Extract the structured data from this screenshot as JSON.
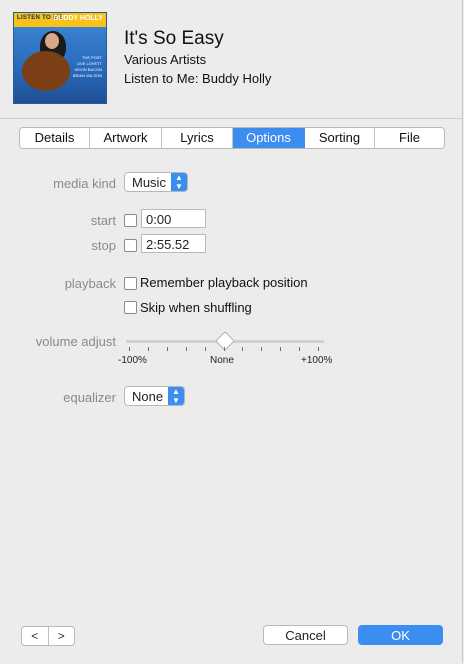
{
  "header": {
    "album_art": {
      "band_left": "LISTEN TO ME",
      "band_right": "BUDDY HOLLY",
      "titles": [
        "THE POST",
        "LIVE LOVETT",
        "KEVIN BACON",
        "BRIAN WILSON"
      ]
    },
    "title": "It's So Easy",
    "artist": "Various Artists",
    "album": "Listen to Me: Buddy Holly"
  },
  "tabs": [
    {
      "label": "Details",
      "active": false
    },
    {
      "label": "Artwork",
      "active": false
    },
    {
      "label": "Lyrics",
      "active": false
    },
    {
      "label": "Options",
      "active": true
    },
    {
      "label": "Sorting",
      "active": false
    },
    {
      "label": "File",
      "active": false
    }
  ],
  "options": {
    "media_kind_label": "media kind",
    "media_kind_value": "Music",
    "start_label": "start",
    "start_value": "0:00",
    "stop_label": "stop",
    "stop_value": "2:55.52",
    "playback_label": "playback",
    "remember_label": "Remember playback position",
    "skip_label": "Skip when shuffling",
    "volume_label": "volume adjust",
    "volume_min": "-100%",
    "volume_mid": "None",
    "volume_max": "+100%",
    "volume_value": 0,
    "equalizer_label": "equalizer",
    "equalizer_value": "None"
  },
  "footer": {
    "prev": "<",
    "next": ">",
    "cancel": "Cancel",
    "ok": "OK"
  },
  "colors": {
    "accent": "#3b8ef0"
  }
}
